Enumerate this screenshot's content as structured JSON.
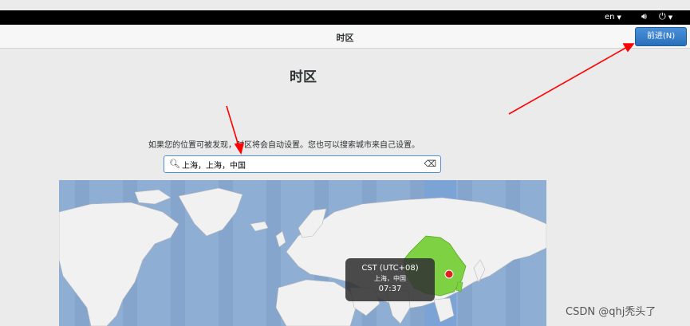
{
  "topbar": {
    "language": "en",
    "volume_icon": "speaker-icon",
    "power_icon": "power-icon"
  },
  "header": {
    "title": "时区",
    "next_button": "前进(N)"
  },
  "main": {
    "title": "时区",
    "description": "如果您的位置可被发现，时区将会自动设置。您也可以搜索城市来自己设置。",
    "search": {
      "value": "上海，上海，中国",
      "search_icon": "search-icon",
      "clear_icon": "clear-icon"
    },
    "map": {
      "tooltip": {
        "timezone": "CST (UTC+08)",
        "location": "上海，中国",
        "time": "07:37"
      },
      "highlight_color": "#7dd142",
      "ocean_color": "#8faed4",
      "land_color": "#f1f1f1"
    }
  },
  "watermark": "CSDN @qhj秃头了",
  "colors": {
    "accent": "#2a6fbb",
    "annotation_arrow": "#ff0000"
  }
}
